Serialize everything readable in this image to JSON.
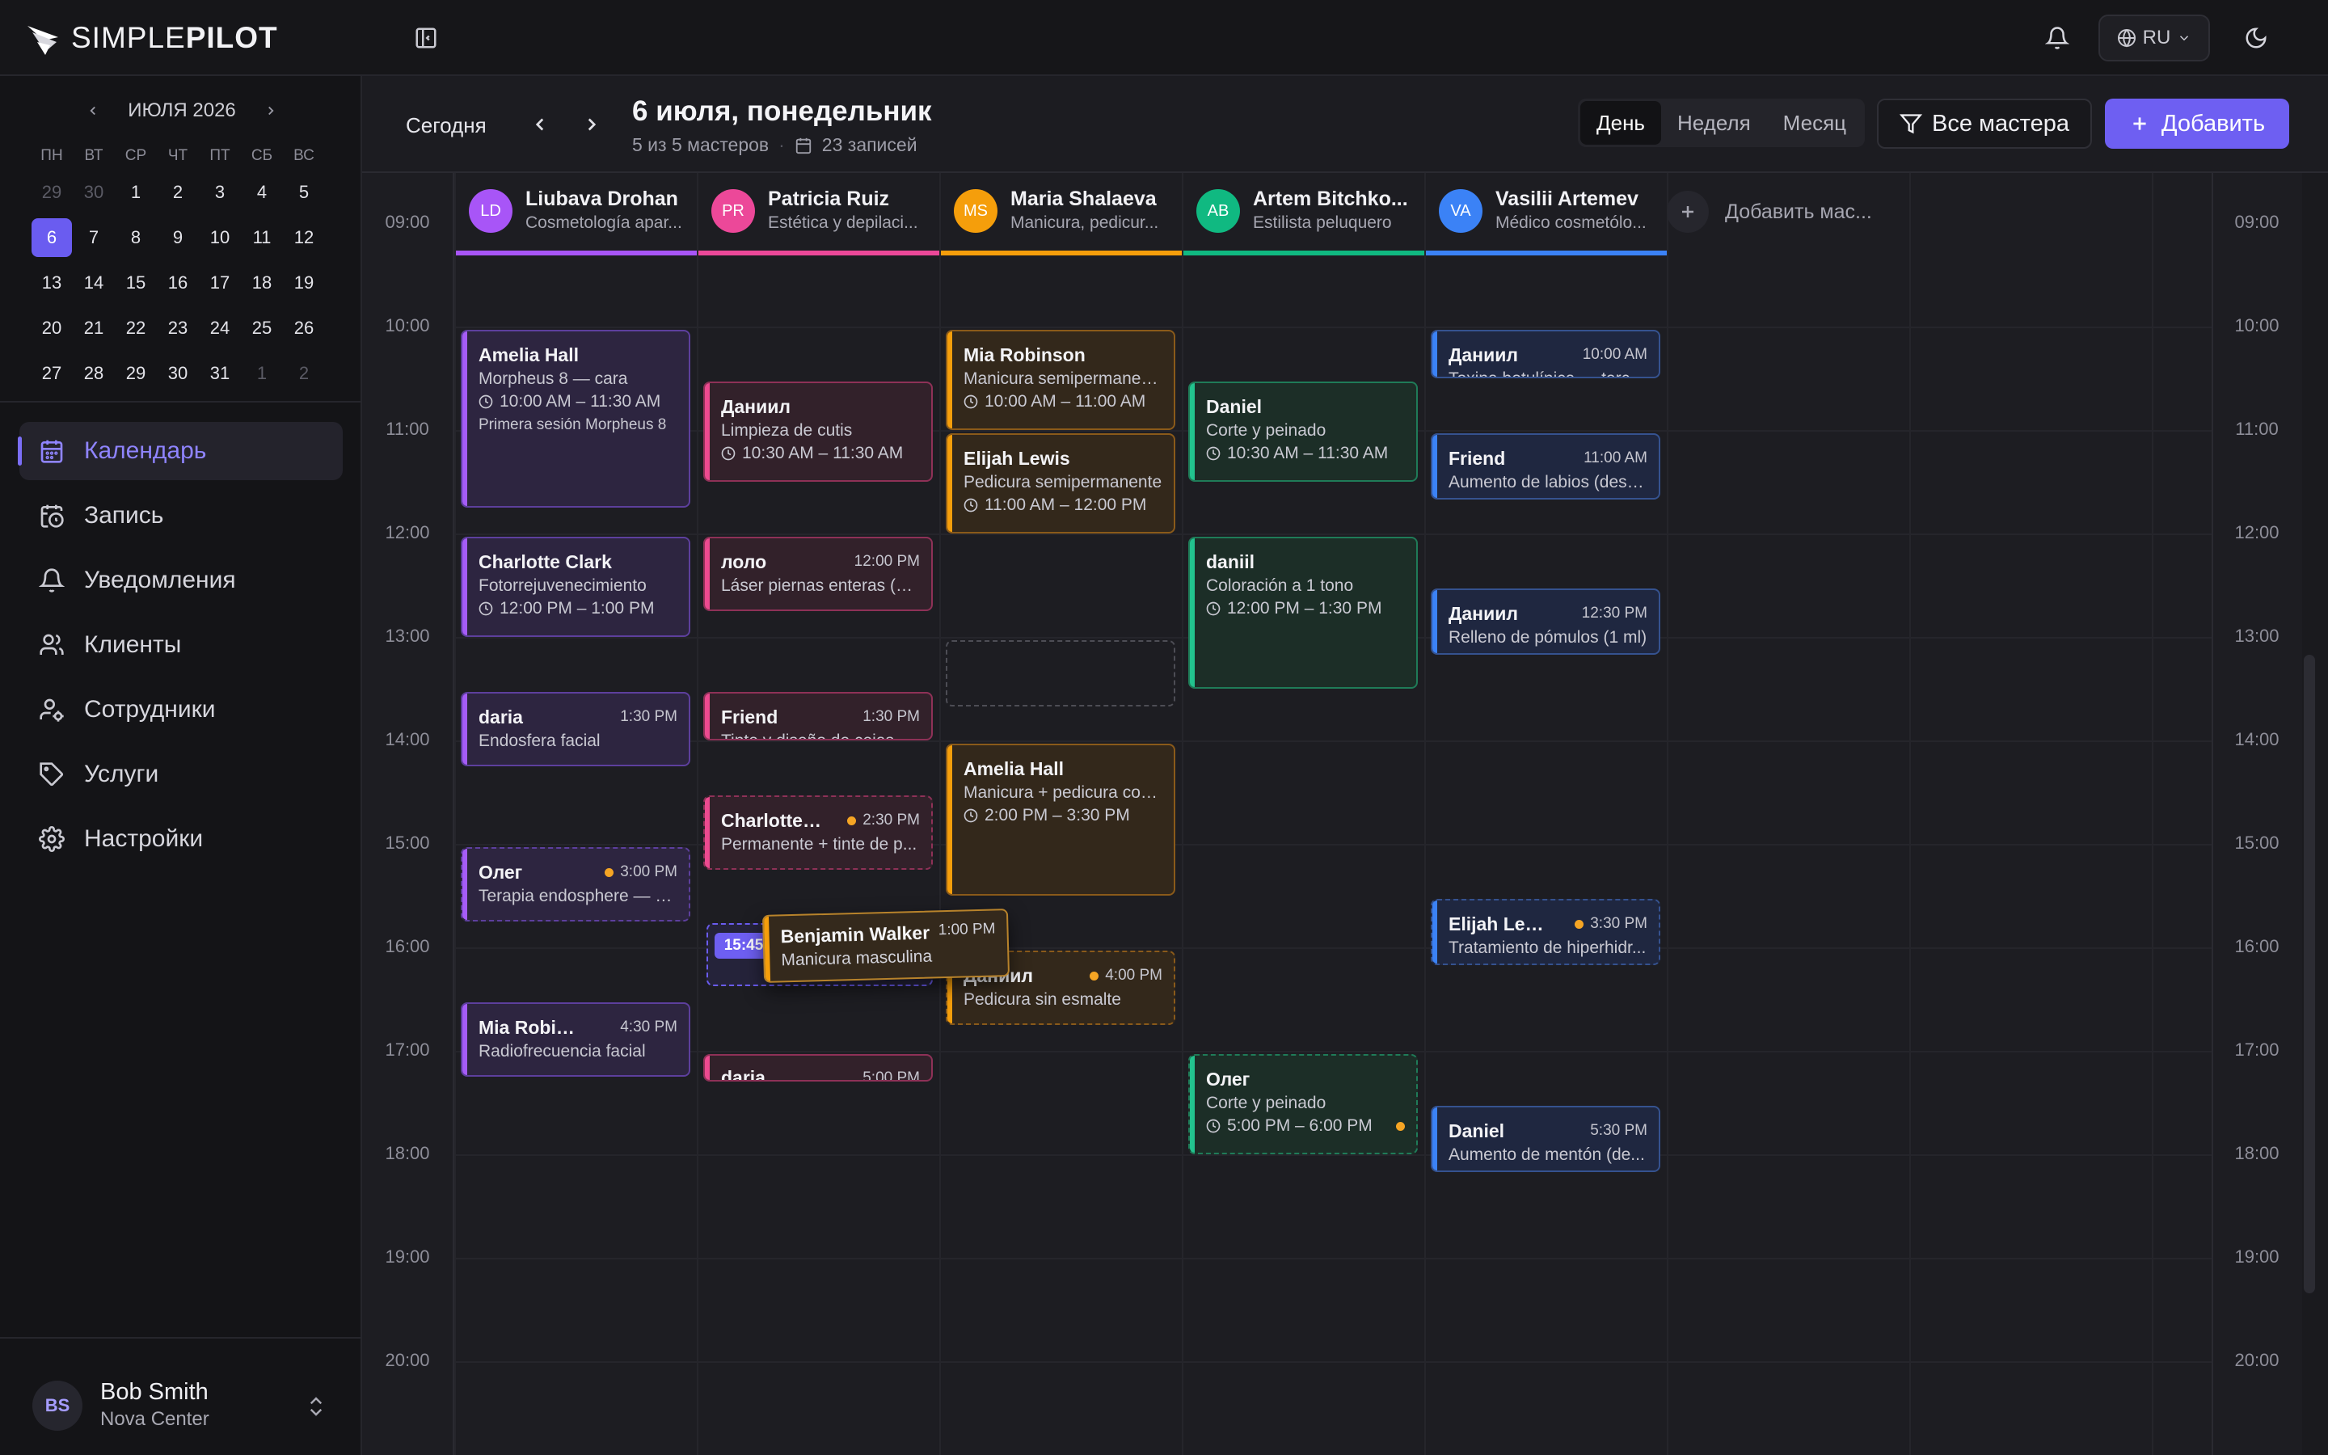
{
  "app": {
    "logo_regular": "SIMPLE",
    "logo_bold": "PILOT"
  },
  "topbar": {
    "language": "RU"
  },
  "mini_calendar": {
    "month_label": "ИЮЛЯ 2026",
    "weekdays": [
      "ПН",
      "ВТ",
      "СР",
      "ЧТ",
      "ПТ",
      "СБ",
      "ВС"
    ],
    "days": [
      {
        "d": "29",
        "muted": true
      },
      {
        "d": "30",
        "muted": true
      },
      {
        "d": "1"
      },
      {
        "d": "2"
      },
      {
        "d": "3"
      },
      {
        "d": "4"
      },
      {
        "d": "5"
      },
      {
        "d": "6",
        "selected": true
      },
      {
        "d": "7"
      },
      {
        "d": "8"
      },
      {
        "d": "9"
      },
      {
        "d": "10"
      },
      {
        "d": "11"
      },
      {
        "d": "12"
      },
      {
        "d": "13"
      },
      {
        "d": "14"
      },
      {
        "d": "15"
      },
      {
        "d": "16"
      },
      {
        "d": "17"
      },
      {
        "d": "18"
      },
      {
        "d": "19"
      },
      {
        "d": "20"
      },
      {
        "d": "21"
      },
      {
        "d": "22"
      },
      {
        "d": "23"
      },
      {
        "d": "24"
      },
      {
        "d": "25"
      },
      {
        "d": "26"
      },
      {
        "d": "27"
      },
      {
        "d": "28"
      },
      {
        "d": "29"
      },
      {
        "d": "30"
      },
      {
        "d": "31"
      },
      {
        "d": "1",
        "muted": true
      },
      {
        "d": "2",
        "muted": true
      }
    ]
  },
  "nav": [
    {
      "label": "Календарь",
      "icon": "calendar-icon",
      "active": true
    },
    {
      "label": "Запись",
      "icon": "calendar-clock-icon"
    },
    {
      "label": "Уведомления",
      "icon": "bell-icon"
    },
    {
      "label": "Клиенты",
      "icon": "users-icon"
    },
    {
      "label": "Сотрудники",
      "icon": "user-cog-icon"
    },
    {
      "label": "Услуги",
      "icon": "tag-icon"
    },
    {
      "label": "Настройки",
      "icon": "settings-gear-icon"
    }
  ],
  "user": {
    "initials": "BS",
    "name": "Bob Smith",
    "org": "Nova Center"
  },
  "header": {
    "today": "Сегодня",
    "title": "6 июля, понедельник",
    "masters_count": "5 из 5 мастеров",
    "bookings_count": "23 записей",
    "views": [
      "День",
      "Неделя",
      "Месяц"
    ],
    "active_view": "День",
    "filter": "Все мастера",
    "add": "Добавить"
  },
  "hours": [
    "09:00",
    "10:00",
    "11:00",
    "12:00",
    "13:00",
    "14:00",
    "15:00",
    "16:00",
    "17:00",
    "18:00",
    "19:00",
    "20:00"
  ],
  "add_staff_label": "Добавить мас...",
  "staff": [
    {
      "initials": "LD",
      "name": "Liubava Drohan",
      "role": "Cosmetología apar...",
      "color": "#a855f7",
      "theme": "purple"
    },
    {
      "initials": "PR",
      "name": "Patricia Ruiz",
      "role": "Estética y depilaci...",
      "color": "#ec4899",
      "theme": "pink"
    },
    {
      "initials": "MS",
      "name": "Maria Shalaeva",
      "role": "Manicura, pedicur...",
      "color": "#f59e0b",
      "theme": "orange"
    },
    {
      "initials": "AB",
      "name": "Artem Bitchko...",
      "role": "Estilista peluquero",
      "color": "#10b981",
      "theme": "green"
    },
    {
      "initials": "VA",
      "name": "Vasilii Artemev",
      "role": "Médico cosmetólo...",
      "color": "#3b82f6",
      "theme": "blue"
    }
  ],
  "events": [
    {
      "col": 0,
      "start": 10.0,
      "end": 11.75,
      "title": "Amelia Hall",
      "sub": "Morpheus 8 — cara",
      "time": "10:00 AM – 11:30 AM",
      "note": "Primera sesión Morpheus 8"
    },
    {
      "col": 0,
      "start": 12.0,
      "end": 13.0,
      "title": "Charlotte Clark",
      "sub": "Fotorrejuvenecimiento",
      "time": "12:00 PM – 1:00 PM"
    },
    {
      "col": 0,
      "start": 13.5,
      "end": 14.25,
      "title": "daria",
      "sub": "Endosfera facial",
      "right": "1:30 PM"
    },
    {
      "col": 0,
      "start": 15.0,
      "end": 15.75,
      "title": "Олег",
      "sub": "Terapia endosphere — s...",
      "right": "3:00 PM",
      "dot": true,
      "dashed": true
    },
    {
      "col": 0,
      "start": 16.5,
      "end": 17.25,
      "title": "Mia Robinson",
      "sub": "Radiofrecuencia facial",
      "right": "4:30 PM"
    },
    {
      "col": 1,
      "start": 10.5,
      "end": 11.5,
      "title": "Даниил",
      "sub": "Limpieza de cutis",
      "time": "10:30 AM – 11:30 AM"
    },
    {
      "col": 1,
      "start": 12.0,
      "end": 12.75,
      "title": "лоло",
      "sub": "Láser piernas enteras (m...",
      "right": "12:00 PM"
    },
    {
      "col": 1,
      "start": 13.5,
      "end": 14.0,
      "title": "Friend",
      "sub": "Tinte y diseño de cejas",
      "right": "1:30 PM"
    },
    {
      "col": 1,
      "start": 14.5,
      "end": 15.25,
      "title": "Charlotte Cl...",
      "sub": "Permanente + tinte de p...",
      "right": "2:30 PM",
      "dot": true,
      "dashed": true
    },
    {
      "col": 1,
      "start": 17.0,
      "end": 17.3,
      "title": "daria",
      "right": "5:00 PM",
      "compact": true
    },
    {
      "col": 2,
      "start": 10.0,
      "end": 11.0,
      "title": "Mia Robinson",
      "sub": "Manicura semipermanente",
      "time": "10:00 AM – 11:00 AM"
    },
    {
      "col": 2,
      "start": 11.0,
      "end": 12.0,
      "title": "Elijah Lewis",
      "sub": "Pedicura semipermanente",
      "time": "11:00 AM – 12:00 PM"
    },
    {
      "col": 2,
      "start": 14.0,
      "end": 15.5,
      "title": "Amelia Hall",
      "sub": "Manicura + pedicura con...",
      "time": "2:00 PM – 3:30 PM"
    },
    {
      "col": 2,
      "start": 16.0,
      "end": 16.75,
      "title": "Даниил",
      "sub": "Pedicura sin esmalte",
      "right": "4:00 PM",
      "dot": true,
      "dashed": true
    },
    {
      "col": 3,
      "start": 10.5,
      "end": 11.5,
      "title": "Daniel",
      "sub": "Corte y peinado",
      "time": "10:30 AM – 11:30 AM"
    },
    {
      "col": 3,
      "start": 12.0,
      "end": 13.5,
      "title": "daniil",
      "sub": "Coloración a 1 tono",
      "time": "12:00 PM – 1:30 PM"
    },
    {
      "col": 3,
      "start": 17.0,
      "end": 18.0,
      "title": "Олег",
      "sub": "Corte y peinado",
      "time": "5:00 PM – 6:00 PM",
      "dot": true,
      "dashed": true
    },
    {
      "col": 4,
      "start": 10.0,
      "end": 10.5,
      "title": "Даниил",
      "sub": "Toxina botulínica — terci...",
      "right": "10:00 AM"
    },
    {
      "col": 4,
      "start": 11.0,
      "end": 11.67,
      "title": "Friend",
      "sub": "Aumento de labios (desde)",
      "right": "11:00 AM"
    },
    {
      "col": 4,
      "start": 12.5,
      "end": 13.17,
      "title": "Даниил",
      "sub": "Relleno de pómulos (1 ml)",
      "right": "12:30 PM"
    },
    {
      "col": 4,
      "start": 15.5,
      "end": 16.17,
      "title": "Elijah Lewis",
      "sub": "Tratamiento de hiperhidr...",
      "right": "3:30 PM",
      "dot": true,
      "dashed": true
    },
    {
      "col": 4,
      "start": 17.5,
      "end": 18.17,
      "title": "Daniel",
      "sub": "Aumento de mentón (de...",
      "right": "5:30 PM"
    }
  ],
  "empty_slot": {
    "col": 2,
    "start": 13.0,
    "end": 13.67
  },
  "drag": {
    "title": "Benjamin Walker",
    "sub": "Manicura masculina",
    "right": "1:00 PM",
    "drop_time": "15:45"
  },
  "colors": {
    "accent": "#6e5ff2",
    "purple": "#a855f7",
    "pink": "#ec4899",
    "orange": "#f59e0b",
    "green": "#10b981",
    "blue": "#3b82f6"
  }
}
